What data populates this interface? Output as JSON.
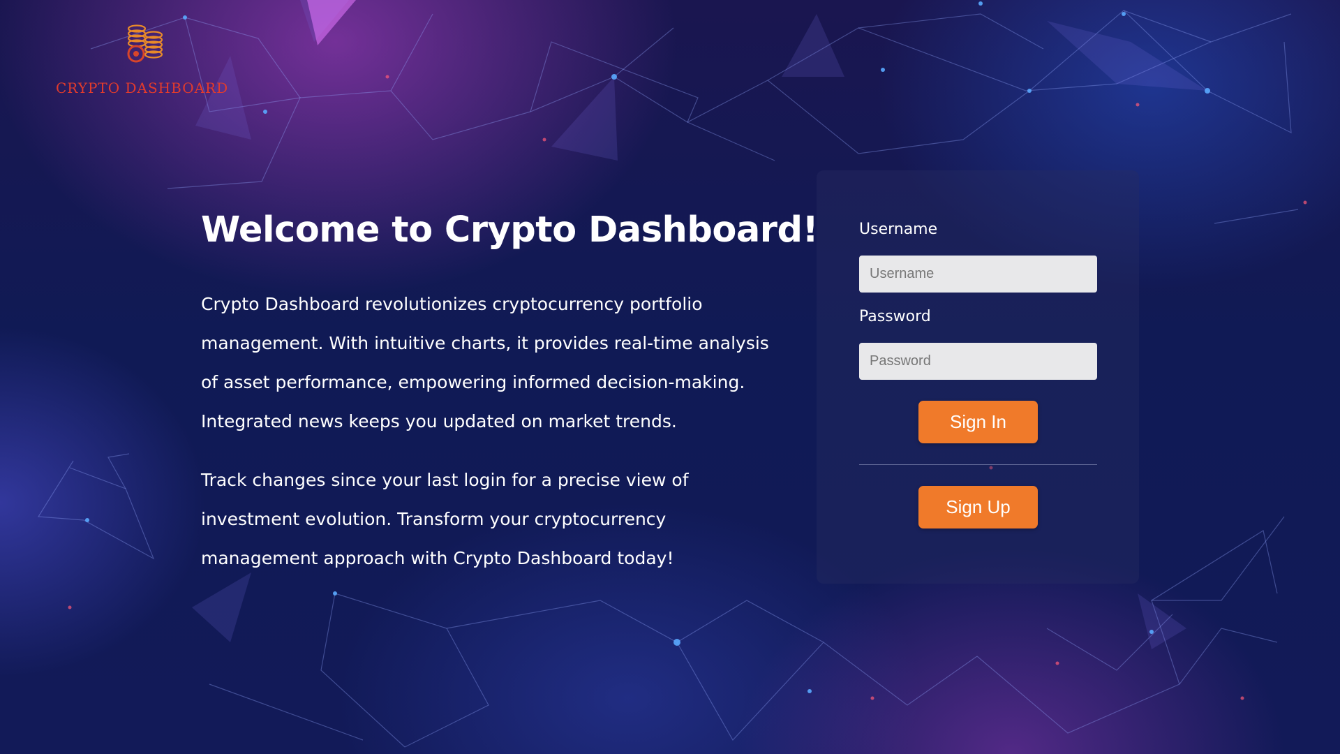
{
  "brand": {
    "name": "CRYPTO DASHBOARD",
    "logo_icon": "coin-stack-icon",
    "color": "#e23b2c"
  },
  "intro": {
    "heading": "Welcome to Crypto Dashboard!",
    "paragraph1": "Crypto Dashboard revolutionizes cryptocurrency portfolio management. With intuitive charts, it provides real-time analysis of asset performance, empowering informed decision-making. Integrated news keeps you updated on market trends.",
    "paragraph2": "Track changes since your last login for a precise view of investment evolution. Transform your cryptocurrency management approach with Crypto Dashboard today!"
  },
  "login": {
    "username_label": "Username",
    "username_placeholder": "Username",
    "username_value": "",
    "password_label": "Password",
    "password_placeholder": "Password",
    "password_value": "",
    "sign_in_label": "Sign In",
    "sign_up_label": "Sign Up"
  },
  "colors": {
    "accent": "#f07a2a",
    "background": "#141a55",
    "input_background": "#e8e8ea"
  }
}
